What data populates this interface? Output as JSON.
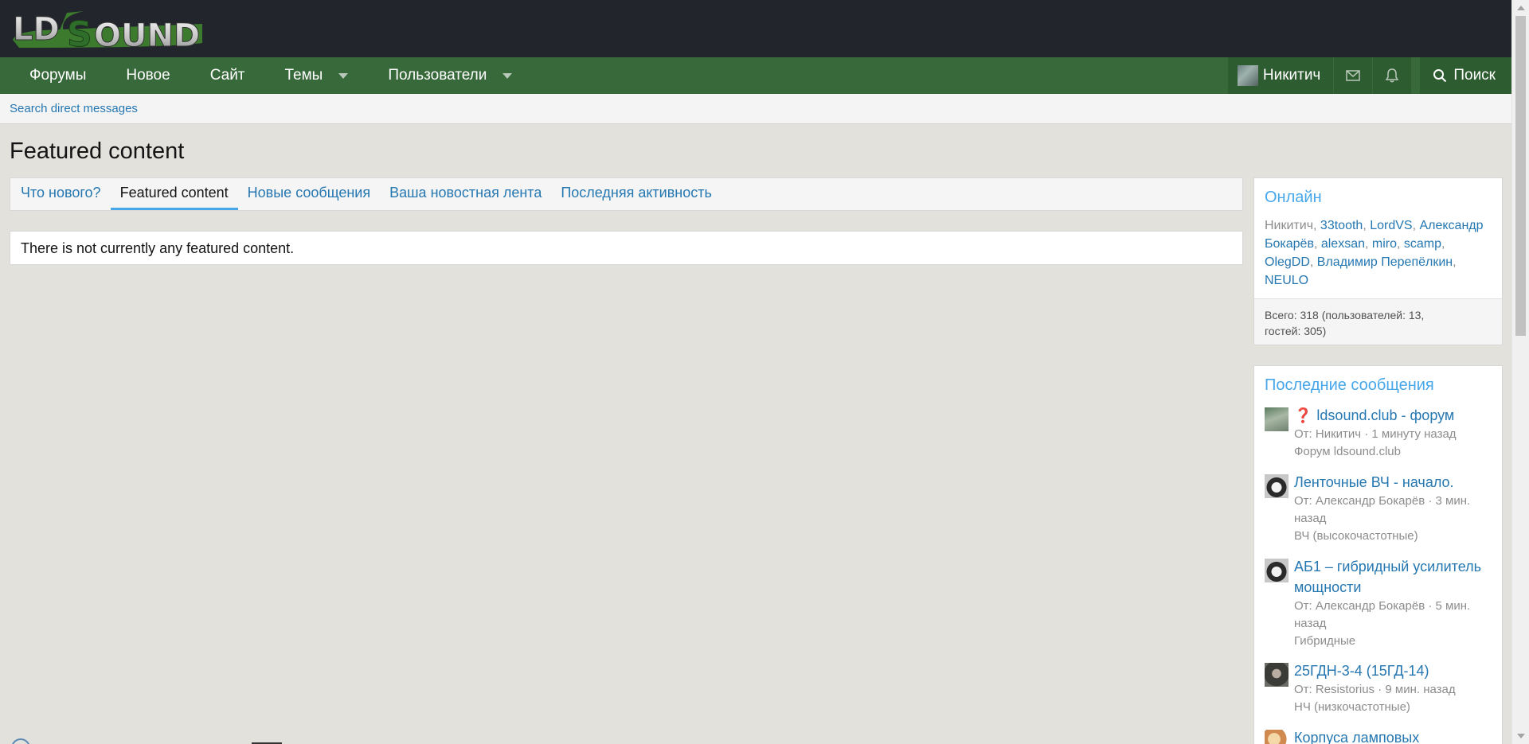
{
  "header": {
    "logo_text": "LDSOUND"
  },
  "nav": {
    "items": [
      {
        "label": "Форумы",
        "has_caret": false
      },
      {
        "label": "Новое",
        "has_caret": false
      },
      {
        "label": "Сайт",
        "has_caret": false
      },
      {
        "label": "Темы",
        "has_caret": true
      },
      {
        "label": "Пользователи",
        "has_caret": true
      }
    ],
    "user_name": "Никитич",
    "inbox_icon": "envelope-icon",
    "alerts_icon": "bell-icon",
    "search_label": "Поиск"
  },
  "subnav": {
    "link": "Search direct messages"
  },
  "page": {
    "title": "Featured content",
    "tabs": [
      {
        "label": "Что нового?",
        "active": false
      },
      {
        "label": "Featured content",
        "active": true
      },
      {
        "label": "Новые сообщения",
        "active": false
      },
      {
        "label": "Ваша новостная лента",
        "active": false
      },
      {
        "label": "Последняя активность",
        "active": false
      }
    ],
    "notice": "There is not currently any featured content."
  },
  "sidebar": {
    "online": {
      "title": "Онлайн",
      "users": [
        "Никитич",
        "33tooth",
        "LordVS",
        "Александр Бокарёв",
        "alexsan",
        "miro",
        "scamp",
        "OlegDD",
        "Владимир Перепёлкин",
        "NEULO"
      ],
      "total_line1": "Всего: 318 (пользователей: 13,",
      "total_line2": "гостей: 305)"
    },
    "latest": {
      "title": "Последние сообщения",
      "posts": [
        {
          "prefix": "❓",
          "title": "ldsound.club - форум",
          "meta": "От: Никитич · 1 минуту назад",
          "forum": "Форум ldsound.club"
        },
        {
          "prefix": "",
          "title": "Ленточные ВЧ - начало.",
          "meta": "От: Александр Бокарёв · 3 мин. назад",
          "forum": "ВЧ (высокочастотные)"
        },
        {
          "prefix": "",
          "title": "АБ1 – гибридный усилитель мощности",
          "meta": "От: Александр Бокарёв · 5 мин. назад",
          "forum": "Гибридные"
        },
        {
          "prefix": "",
          "title": "25ГДН-3-4 (15ГД-14)",
          "meta": "От: Resistorius · 9 мин. назад",
          "forum": "НЧ (низкочастотные)"
        },
        {
          "prefix": "",
          "title": "Корпуса ламповых",
          "meta": "",
          "forum": ""
        }
      ]
    }
  },
  "colors": {
    "header_bg": "#22262c",
    "nav_bg": "#37693a",
    "link": "#2577b1",
    "accent": "#47a7eb",
    "page_bg": "#e2e1dc"
  }
}
